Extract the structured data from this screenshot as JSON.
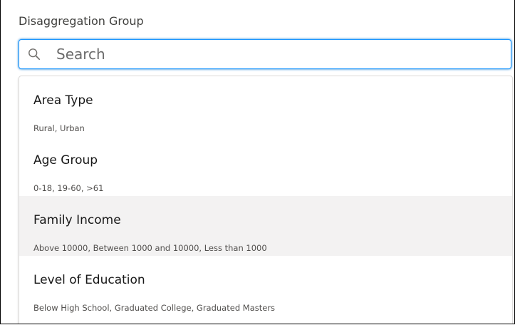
{
  "field": {
    "label": "Disaggregation Group"
  },
  "search": {
    "placeholder": "Search",
    "value": "",
    "icon": "search-icon"
  },
  "options": [
    {
      "title": "Area Type",
      "values": "Rural, Urban",
      "hovered": false
    },
    {
      "title": "Age Group",
      "values": "0-18, 19-60, >61",
      "hovered": false
    },
    {
      "title": "Family Income",
      "values": "Above 10000, Between 1000 and 10000, Less than 1000",
      "hovered": true
    },
    {
      "title": "Level of Education",
      "values": "Below High School, Graduated College, Graduated Masters",
      "hovered": false
    }
  ],
  "colors": {
    "focus_border": "#1b96ff",
    "hover_bg": "#f3f2f2",
    "text": "#181818",
    "subtext": "#514f4d"
  }
}
